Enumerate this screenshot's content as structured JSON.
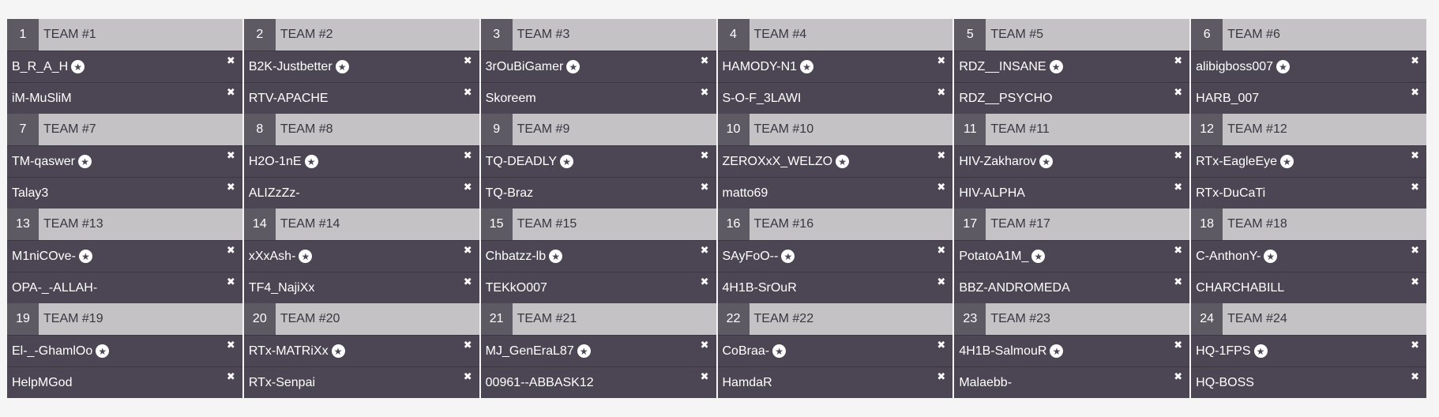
{
  "icons": {
    "captain": "star-icon",
    "remove": "close-icon"
  },
  "symbols": {
    "star": "★",
    "remove": "✖"
  },
  "colors": {
    "page_bg": "#f5f5f5",
    "header_bg": "#c4c2c5",
    "number_bg": "#5e5a63",
    "player_bg": "#4c4654",
    "text_light": "#ffffff",
    "text_dark": "#3a3640"
  },
  "teams": [
    {
      "number": "1",
      "name": "TEAM #1",
      "players": [
        {
          "name": "B_R_A_H",
          "captain": true
        },
        {
          "name": "iM-MuSliM",
          "captain": false
        }
      ]
    },
    {
      "number": "2",
      "name": "TEAM #2",
      "players": [
        {
          "name": "B2K-Justbetter",
          "captain": true
        },
        {
          "name": "RTV-APACHE",
          "captain": false
        }
      ]
    },
    {
      "number": "3",
      "name": "TEAM #3",
      "players": [
        {
          "name": "3rOuBiGamer",
          "captain": true
        },
        {
          "name": "Skoreem",
          "captain": false
        }
      ]
    },
    {
      "number": "4",
      "name": "TEAM #4",
      "players": [
        {
          "name": "HAMODY-N1",
          "captain": true
        },
        {
          "name": "S-O-F_3LAWI",
          "captain": false
        }
      ]
    },
    {
      "number": "5",
      "name": "TEAM #5",
      "players": [
        {
          "name": "RDZ__INSANE",
          "captain": true
        },
        {
          "name": "RDZ__PSYCHO",
          "captain": false
        }
      ]
    },
    {
      "number": "6",
      "name": "TEAM #6",
      "players": [
        {
          "name": "alibigboss007",
          "captain": true
        },
        {
          "name": "HARB_007",
          "captain": false
        }
      ]
    },
    {
      "number": "7",
      "name": "TEAM #7",
      "players": [
        {
          "name": "TM-qaswer",
          "captain": true
        },
        {
          "name": "Talay3",
          "captain": false
        }
      ]
    },
    {
      "number": "8",
      "name": "TEAM #8",
      "players": [
        {
          "name": "H2O-1nE",
          "captain": true
        },
        {
          "name": "ALIZzZz-",
          "captain": false
        }
      ]
    },
    {
      "number": "9",
      "name": "TEAM #9",
      "players": [
        {
          "name": "TQ-DEADLY",
          "captain": true
        },
        {
          "name": "TQ-Braz",
          "captain": false
        }
      ]
    },
    {
      "number": "10",
      "name": "TEAM #10",
      "players": [
        {
          "name": "ZEROXxX_WELZO",
          "captain": true
        },
        {
          "name": "matto69",
          "captain": false
        }
      ]
    },
    {
      "number": "11",
      "name": "TEAM #11",
      "players": [
        {
          "name": "HIV-Zakharov",
          "captain": true
        },
        {
          "name": "HIV-ALPHA",
          "captain": false
        }
      ]
    },
    {
      "number": "12",
      "name": "TEAM #12",
      "players": [
        {
          "name": "RTx-EagleEye",
          "captain": true
        },
        {
          "name": "RTx-DuCaTi",
          "captain": false
        }
      ]
    },
    {
      "number": "13",
      "name": "TEAM #13",
      "players": [
        {
          "name": "M1niCOve-",
          "captain": true
        },
        {
          "name": "OPA-_-ALLAH-",
          "captain": false
        }
      ]
    },
    {
      "number": "14",
      "name": "TEAM #14",
      "players": [
        {
          "name": "xXxAsh-",
          "captain": true
        },
        {
          "name": "TF4_NajiXx",
          "captain": false
        }
      ]
    },
    {
      "number": "15",
      "name": "TEAM #15",
      "players": [
        {
          "name": "Chbatzz-lb",
          "captain": true
        },
        {
          "name": "TEKkO007",
          "captain": false
        }
      ]
    },
    {
      "number": "16",
      "name": "TEAM #16",
      "players": [
        {
          "name": "SAyFoO--",
          "captain": true
        },
        {
          "name": "4H1B-SrOuR",
          "captain": false
        }
      ]
    },
    {
      "number": "17",
      "name": "TEAM #17",
      "players": [
        {
          "name": "PotatoA1M_",
          "captain": true
        },
        {
          "name": "BBZ-ANDROMEDA",
          "captain": false
        }
      ]
    },
    {
      "number": "18",
      "name": "TEAM #18",
      "players": [
        {
          "name": "C-AnthonY-",
          "captain": true
        },
        {
          "name": "CHARCHABILL",
          "captain": false
        }
      ]
    },
    {
      "number": "19",
      "name": "TEAM #19",
      "players": [
        {
          "name": "El-_-GhamlOo",
          "captain": true
        },
        {
          "name": "HelpMGod",
          "captain": false
        }
      ]
    },
    {
      "number": "20",
      "name": "TEAM #20",
      "players": [
        {
          "name": "RTx-MATRiXx",
          "captain": true
        },
        {
          "name": "RTx-Senpai",
          "captain": false
        }
      ]
    },
    {
      "number": "21",
      "name": "TEAM #21",
      "players": [
        {
          "name": "MJ_GenEraL87",
          "captain": true
        },
        {
          "name": "00961--ABBASK12",
          "captain": false
        }
      ]
    },
    {
      "number": "22",
      "name": "TEAM #22",
      "players": [
        {
          "name": "CoBraa-",
          "captain": true
        },
        {
          "name": "HamdaR",
          "captain": false
        }
      ]
    },
    {
      "number": "23",
      "name": "TEAM #23",
      "players": [
        {
          "name": "4H1B-SalmouR",
          "captain": true
        },
        {
          "name": "Malaebb-",
          "captain": false
        }
      ]
    },
    {
      "number": "24",
      "name": "TEAM #24",
      "players": [
        {
          "name": "HQ-1FPS",
          "captain": true
        },
        {
          "name": "HQ-BOSS",
          "captain": false
        }
      ]
    }
  ]
}
